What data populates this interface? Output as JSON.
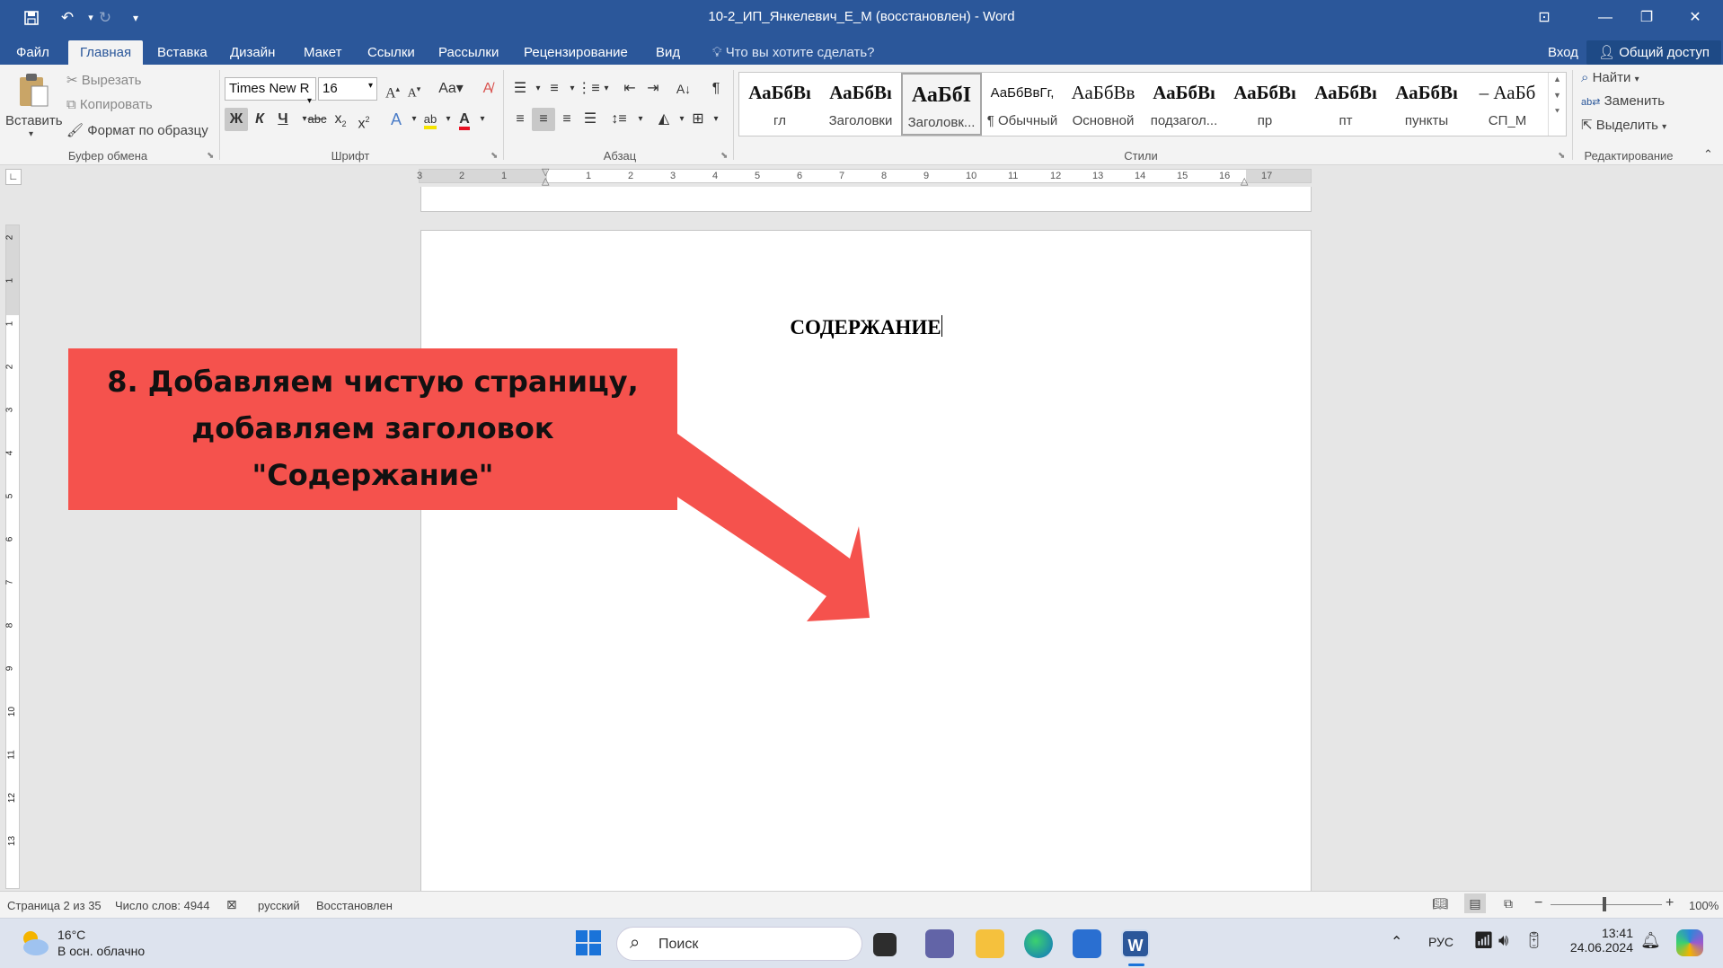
{
  "window": {
    "title": "10-2_ИП_Янкелевич_Е_М (восстановлен) - Word",
    "signin": "Вход",
    "share": "Общий доступ"
  },
  "tabs": [
    "Файл",
    "Главная",
    "Вставка",
    "Дизайн",
    "Макет",
    "Ссылки",
    "Рассылки",
    "Рецензирование",
    "Вид"
  ],
  "active_tab": "Главная",
  "tell_me": "Что вы хотите сделать?",
  "clipboard": {
    "paste": "Вставить",
    "cut": "Вырезать",
    "copy": "Копировать",
    "format_painter": "Формат по образцу",
    "group": "Буфер обмена"
  },
  "font": {
    "name": "Times New R",
    "size": "16",
    "group": "Шрифт",
    "bold": "Ж",
    "italic": "К",
    "underline": "Ч",
    "strike": "abc"
  },
  "paragraph": {
    "group": "Абзац"
  },
  "styles": {
    "group": "Стили",
    "items": [
      {
        "preview": "АаБбВı",
        "name": "гл"
      },
      {
        "preview": "АаБбВı",
        "name": "Заголовки"
      },
      {
        "preview": "АаБбI",
        "name": "Заголовк..."
      },
      {
        "preview": "АаБбВвГг,",
        "name": "¶ Обычный"
      },
      {
        "preview": "АаБбВв",
        "name": "Основной"
      },
      {
        "preview": "АаБбВı",
        "name": "подзагол..."
      },
      {
        "preview": "АаБбВı",
        "name": "пр"
      },
      {
        "preview": "АаБбВı",
        "name": "пт"
      },
      {
        "preview": "АаБбВı",
        "name": "пункты"
      },
      {
        "preview": "– АаБб",
        "name": "СП_М"
      }
    ]
  },
  "editing": {
    "group": "Редактирование",
    "find": "Найти",
    "replace": "Заменить",
    "select": "Выделить"
  },
  "ruler": {
    "marks": [
      "3",
      "2",
      "1",
      "1",
      "2",
      "3",
      "4",
      "5",
      "6",
      "7",
      "8",
      "9",
      "10",
      "11",
      "12",
      "13",
      "14",
      "15",
      "16",
      "17"
    ],
    "vmarks": [
      "2",
      "1",
      "1",
      "2",
      "3",
      "4",
      "5",
      "6",
      "7",
      "8",
      "9",
      "10",
      "11",
      "12",
      "13"
    ]
  },
  "document": {
    "heading": "СОДЕРЖАНИЕ"
  },
  "callout": {
    "line1": "8. Добавляем чистую страницу,",
    "line2": "добавляем заголовок",
    "line3": "\"Содержание\"",
    "color": "#f5524d"
  },
  "statusbar": {
    "page": "Страница 2 из 35",
    "words": "Число слов: 4944",
    "language": "русский",
    "state": "Восстановлен",
    "zoom": "100%"
  },
  "taskbar": {
    "weather_temp": "16°C",
    "weather_desc": "В осн. облачно",
    "search": "Поиск",
    "lang": "РУС",
    "time": "13:41",
    "date": "24.06.2024"
  }
}
